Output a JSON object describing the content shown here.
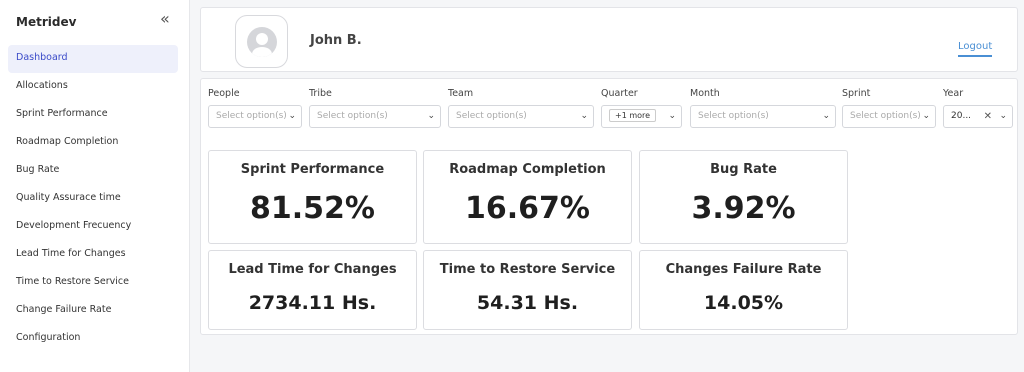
{
  "sidebar": {
    "brand": "Metridev",
    "collapse_icon": "«",
    "items": [
      {
        "label": "Dashboard",
        "active": true
      },
      {
        "label": "Allocations"
      },
      {
        "label": "Sprint Performance"
      },
      {
        "label": "Roadmap Completion"
      },
      {
        "label": "Bug Rate"
      },
      {
        "label": "Quality Assurace time"
      },
      {
        "label": "Development Frecuency"
      },
      {
        "label": "Lead Time for Changes"
      },
      {
        "label": "Time to Restore Service"
      },
      {
        "label": "Change Failure Rate"
      },
      {
        "label": "Configuration"
      }
    ]
  },
  "header": {
    "user_name": "John B.",
    "logout_label": "Logout"
  },
  "filters": {
    "people": {
      "label": "People",
      "placeholder": "Select option(s)"
    },
    "tribe": {
      "label": "Tribe",
      "placeholder": "Select option(s)"
    },
    "team": {
      "label": "Team",
      "placeholder": "Select option(s)"
    },
    "quarter": {
      "label": "Quarter",
      "tag": "+1 more"
    },
    "month": {
      "label": "Month",
      "placeholder": "Select option(s)"
    },
    "sprint": {
      "label": "Sprint",
      "placeholder": "Select option(s)"
    },
    "year": {
      "label": "Year",
      "value": "20...",
      "clear": "✕"
    }
  },
  "metrics": [
    {
      "title": "Sprint Performance",
      "value": "81.52%"
    },
    {
      "title": "Roadmap Completion",
      "value": "16.67%"
    },
    {
      "title": "Bug Rate",
      "value": "3.92%"
    },
    {
      "title": "Lead Time for Changes",
      "value": "2734.11 Hs."
    },
    {
      "title": "Time to Restore Service",
      "value": "54.31 Hs."
    },
    {
      "title": "Changes Failure Rate",
      "value": "14.05%"
    }
  ],
  "colors": {
    "accent": "#3a4ac8",
    "link": "#4a8fd4",
    "active_bg": "#eef0fb"
  }
}
